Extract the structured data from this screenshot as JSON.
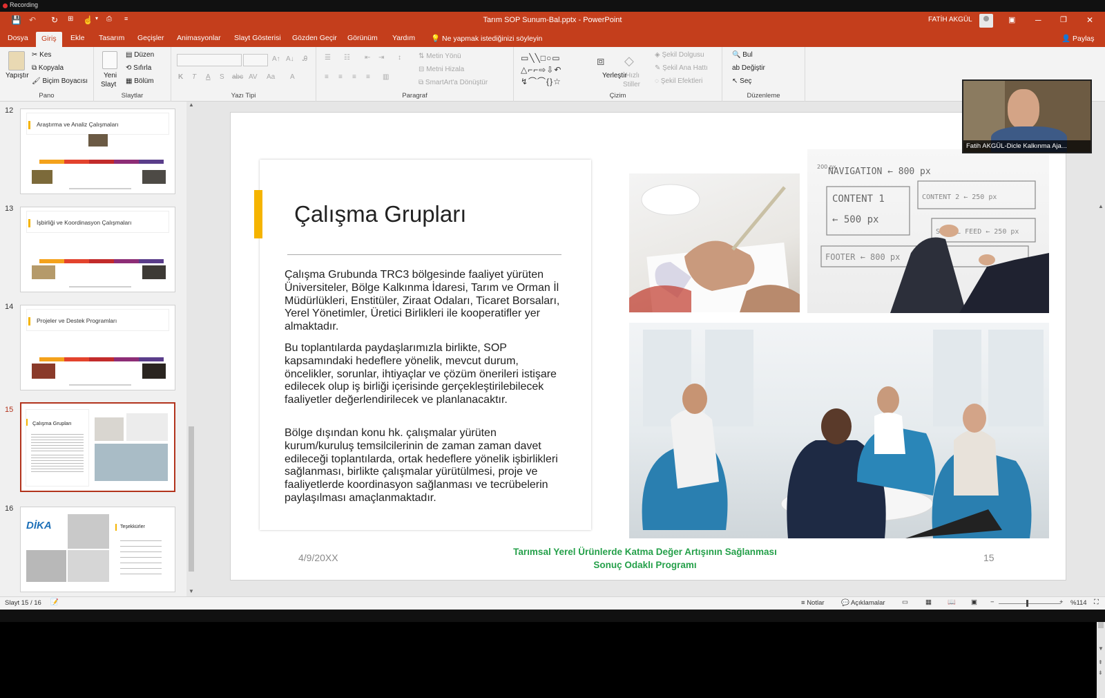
{
  "recording": {
    "label": "Recording"
  },
  "titlebar": {
    "doc_title": "Tarım SOP Sunum-Bal.pptx  -  PowerPoint",
    "user": "FATİH AKGÜL"
  },
  "tabs": [
    "Dosya",
    "Giriş",
    "Ekle",
    "Tasarım",
    "Geçişler",
    "Animasyonlar",
    "Slayt Gösterisi",
    "Gözden Geçir",
    "Görünüm",
    "Yardım"
  ],
  "tell_me": "Ne yapmak istediğinizi söyleyin",
  "share": "Paylaş",
  "ribbon": {
    "pano": {
      "label": "Pano",
      "paste": "Yapıştır",
      "cut": "Kes",
      "copy": "Kopyala",
      "format_painter": "Biçim Boyacısı"
    },
    "slaytlar": {
      "label": "Slaytlar",
      "new_slide_1": "Yeni",
      "new_slide_2": "Slayt",
      "layout": "Düzen",
      "reset": "Sıfırla",
      "section": "Bölüm"
    },
    "yazi_tipi": {
      "label": "Yazı Tipi"
    },
    "paragraf": {
      "label": "Paragraf",
      "text_direction": "Metin Yönü",
      "align_text": "Metni Hizala",
      "smartart": "SmartArt'a Dönüştür"
    },
    "cizim": {
      "label": "Çizim",
      "arrange": "Yerleştir",
      "quick_styles_1": "Hızlı",
      "quick_styles_2": "Stiller",
      "shape_fill": "Şekil Dolgusu",
      "shape_outline": "Şekil Ana Hattı",
      "shape_effects": "Şekil Efektleri"
    },
    "duzenleme": {
      "label": "Düzenleme",
      "find": "Bul",
      "replace": "Değiştir",
      "select": "Seç"
    }
  },
  "thumbnails": [
    {
      "num": "12",
      "title": "Araştırma ve Analiz Çalışmaları"
    },
    {
      "num": "13",
      "title": "İşbirliği ve Koordinasyon Çalışmaları"
    },
    {
      "num": "14",
      "title": "Projeler ve Destek Programları"
    },
    {
      "num": "15",
      "title": "Çalışma Grupları"
    },
    {
      "num": "16",
      "title": "Teşekkürler",
      "logo": "DİKA"
    }
  ],
  "slide": {
    "title": "Çalışma Grupları",
    "paragraphs": [
      "Çalışma Grubunda TRC3 bölgesinde faaliyet yürüten Üniversiteler, Bölge Kalkınma İdaresi, Tarım ve Orman İl Müdürlükleri, Enstitüler, Ziraat Odaları, Ticaret Borsaları, Yerel Yönetimler, Üretici Birlikleri ile kooperatifler yer almaktadır.",
      "Bu toplantılarda paydaşlarımızla birlikte, SOP kapsamındaki hedeflere yönelik, mevcut durum, öncelikler, sorunlar, ihtiyaçlar ve çözüm önerileri istişare edilecek olup iş birliği içerisinde gerçekleştirilebilecek faaliyetler değerlendirilecek ve planlanacaktır.",
      "Bölge dışından konu hk. çalışmalar yürüten kurum/kuruluş temsilcilerinin de zaman zaman davet edileceği toplantılarda, ortak hedeflere yönelik işbirlikleri sağlanması, birlikte çalışmalar yürütülmesi, proje ve faaliyetlerde koordinasyon sağlanması ve tecrübelerin paylaşılması amaçlanmaktadır."
    ],
    "date": "4/9/20XX",
    "footer_line1": "Tarımsal Yerel Ürünlerde Katma Değer Artışının Sağlanması",
    "footer_line2": "Sonuç Odaklı Programı",
    "number": "15",
    "whiteboard_text": [
      "NAVIGATION ← 800 px",
      "CONTENT 1",
      "← 500 px",
      "CONTENT 2 ← 250 px",
      "SOCIAL FEED ← 250 px",
      "FOOTER ← 800 px",
      "200 px"
    ]
  },
  "webcam": {
    "label": "Fatih AKGÜL-Dicle Kalkınma Aja..."
  },
  "status": {
    "slide": "Slayt 15 / 16",
    "notes": "Notlar",
    "comments": "Açıklamalar",
    "zoom": "%114"
  },
  "colors": {
    "accent": "#c43e1c",
    "title_bar_accent": "#f5b400",
    "footer_green": "#25a04a",
    "selected_thumb": "#b2331c"
  }
}
